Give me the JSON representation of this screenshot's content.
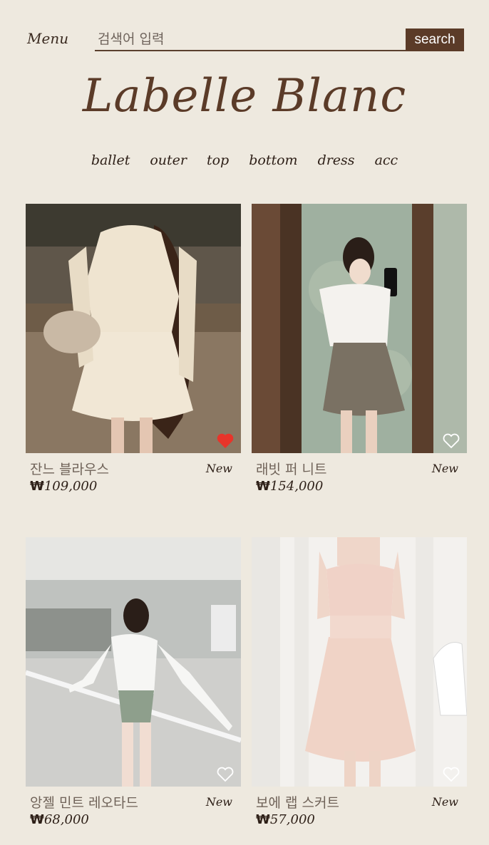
{
  "header": {
    "menu_label": "Menu",
    "search_placeholder": "검색어 입력",
    "search_value": "",
    "search_button_label": "search",
    "brand_title": "Labelle Blanc"
  },
  "categories": [
    "ballet",
    "outer",
    "top",
    "bottom",
    "dress",
    "acc"
  ],
  "products": [
    {
      "name": "잔느 블라우스",
      "badge": "New",
      "currency": "₩",
      "price": "109,000",
      "favorited": true
    },
    {
      "name": "래빗 퍼 니트",
      "badge": "New",
      "currency": "₩",
      "price": "154,000",
      "favorited": false
    },
    {
      "name": "앙젤 민트 레오타드",
      "badge": "New",
      "currency": "₩",
      "price": "68,000",
      "favorited": false
    },
    {
      "name": "보에 랩 스커트",
      "badge": "New",
      "currency": "₩",
      "price": "57,000",
      "favorited": false
    }
  ],
  "colors": {
    "background": "#eee9df",
    "brand_brown": "#5b3b28",
    "heart_active": "#e8342a",
    "heart_inactive": "#ffffff"
  }
}
